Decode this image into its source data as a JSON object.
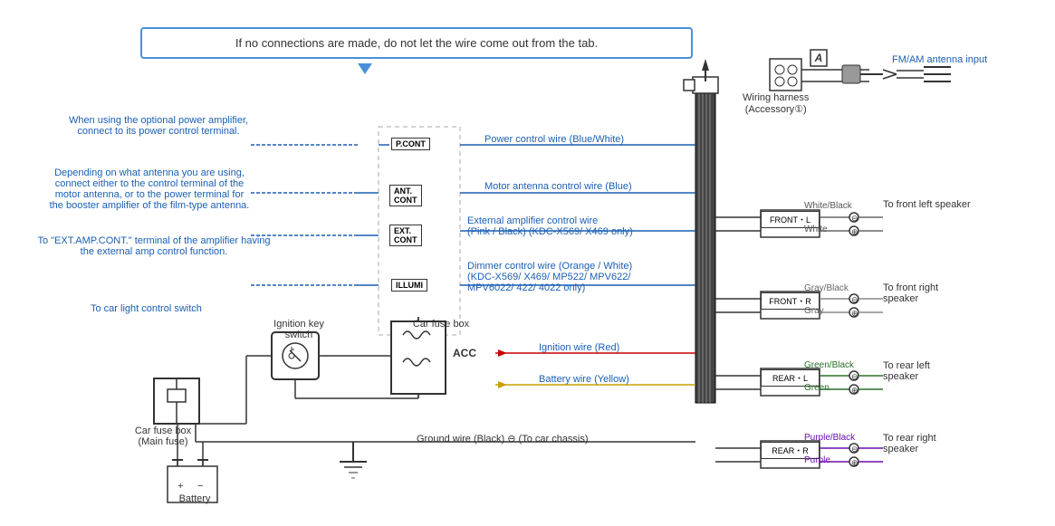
{
  "callout": {
    "text": "If no connections are made, do not let the wire come out from the tab."
  },
  "notes": {
    "note1": "When using the optional power amplifier,",
    "note1b": "connect to its power control terminal.",
    "note2": "Depending on what antenna you are using,",
    "note2b": "connect either to the control terminal of the",
    "note2c": "motor antenna, or to the power terminal for",
    "note2d": "the booster amplifier of the film-type antenna.",
    "note3": "To \"EXT.AMP.CONT.\" terminal of the amplifier having",
    "note3b": "the external amp control function.",
    "note4": "To car light control switch"
  },
  "wire_labels": {
    "power_ctrl": "Power control wire (Blue/White)",
    "motor_ant": "Motor antenna control wire (Blue)",
    "ext_amp": "External amplifier control wire",
    "ext_amp2": "(Pink / Black) (KDC-X569/ X469 only)",
    "dimmer": "Dimmer control wire (Orange / White)",
    "dimmer2": "(KDC-X569/ X469/ MP522/ MPV622/",
    "dimmer3": "MPV6022/ 422/ 4022 only)",
    "ignition": "Ignition wire (Red)",
    "battery": "Battery wire (Yellow)",
    "ground": "Ground wire (Black) ⊖ (To car chassis)"
  },
  "terminals": {
    "pcont": "P.CONT",
    "antcont": "ANT.\nCONT",
    "extcont": "EXT.\nCONT",
    "illumi": "ILLUMI"
  },
  "harness": {
    "title": "Wiring harness",
    "subtitle": "(Accessory①)"
  },
  "antenna": {
    "label": "FM/AM antenna input"
  },
  "speakers": {
    "front_left": {
      "connector": "FRONT・L",
      "color1": "White/Black",
      "color2": "White",
      "symbol1": "⊖",
      "symbol2": "⊕",
      "label": "To front left\nspeaker"
    },
    "front_right": {
      "connector": "FRONT・R",
      "color1": "Gray/Black",
      "color2": "Gray",
      "symbol1": "⊖",
      "symbol2": "⊕",
      "label": "To front right\nspeaker"
    },
    "rear_left": {
      "connector": "REAR・L",
      "color1": "Green/Black",
      "color2": "Green",
      "symbol1": "⊖",
      "symbol2": "⊕",
      "label": "To rear left\nspeaker"
    },
    "rear_right": {
      "connector": "REAR・R",
      "color1": "Purple/Black",
      "color2": "Purple",
      "symbol1": "⊖",
      "symbol2": "⊕",
      "label": "To rear right\nspeaker"
    }
  },
  "components": {
    "ignition_key": "Ignition key\nswitch",
    "car_fuse_main": "Car fuse box\n(Main fuse)",
    "car_fuse_box": "Car fuse\nbox",
    "acc": "ACC",
    "battery": "Battery"
  }
}
